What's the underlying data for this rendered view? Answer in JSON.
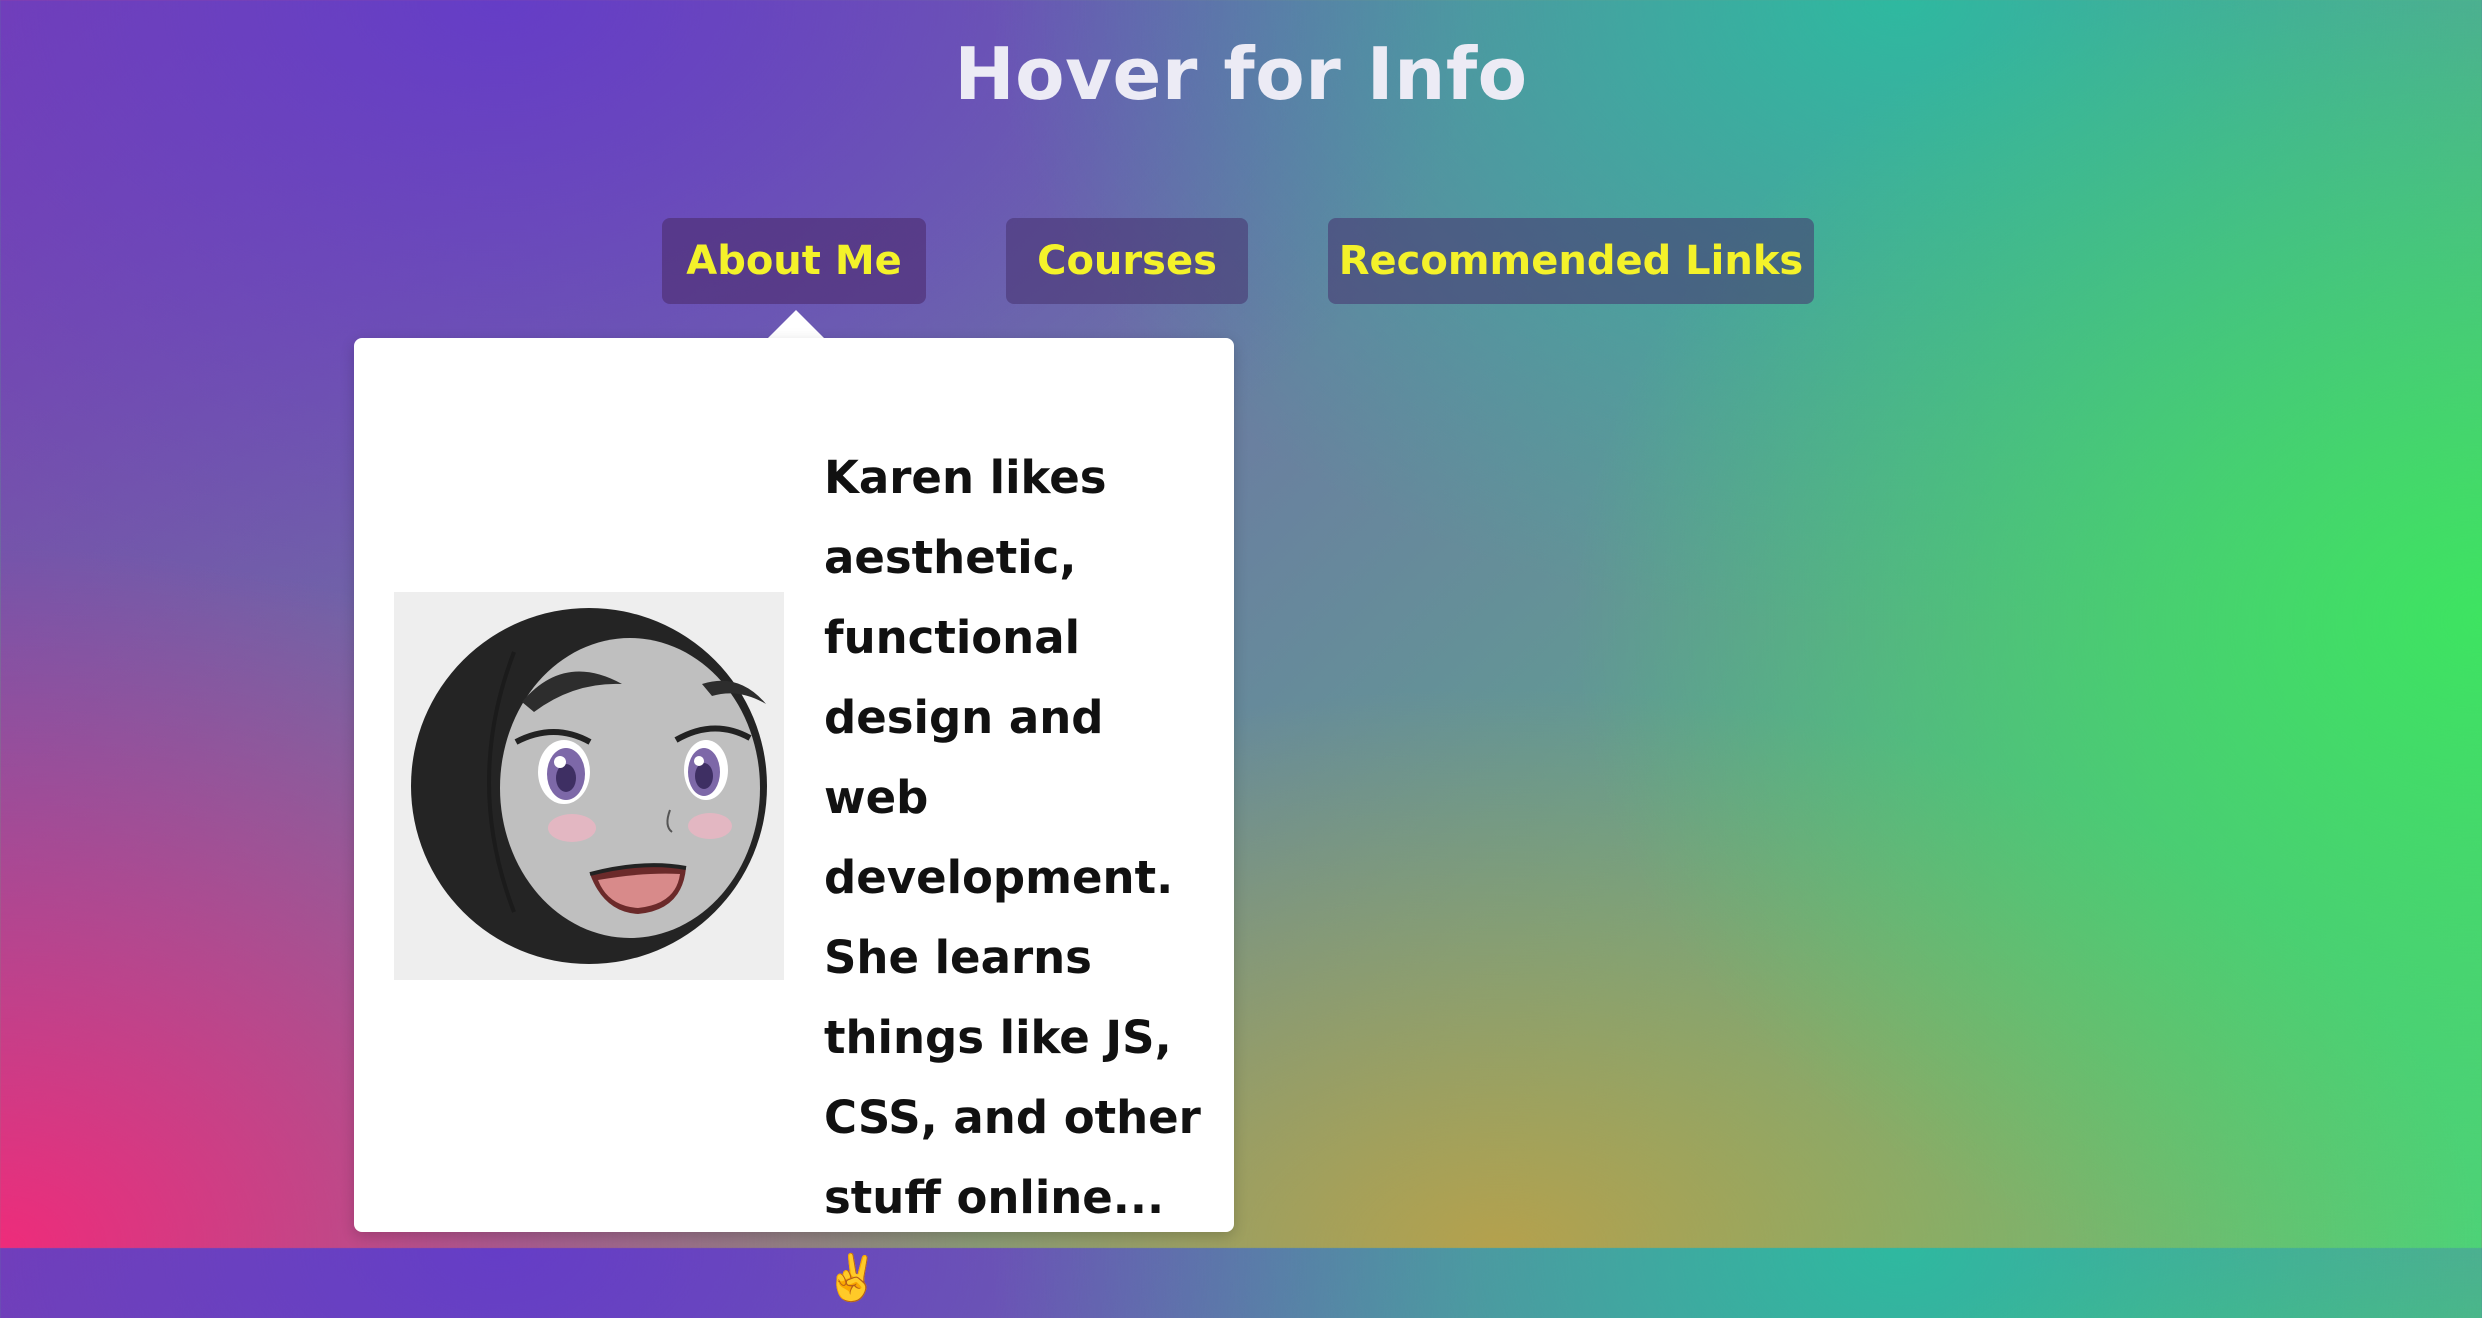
{
  "page": {
    "title": "Hover for Info"
  },
  "nav": {
    "about_label": "About Me",
    "courses_label": "Courses",
    "links_label": "Recommended Links"
  },
  "popup": {
    "bio_text": "Karen likes aesthetic, functional design and web development. She learns things like JS, CSS, and other stuff online...✌️",
    "avatar_icon": "anime-face-avatar"
  },
  "colors": {
    "nav_text": "#f4f22a",
    "title_text": "#ecebf5",
    "popup_bg": "#ffffff"
  }
}
